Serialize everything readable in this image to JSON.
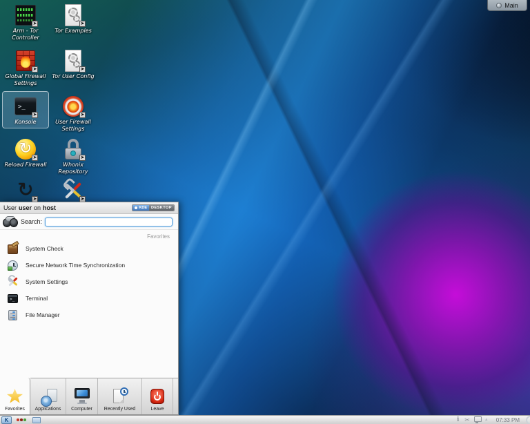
{
  "desktop": {
    "main_button_label": "Main",
    "icons": [
      {
        "label": "Arm - Tor Controller"
      },
      {
        "label": "Tor Examples"
      },
      {
        "label": "Global Firewall Settings"
      },
      {
        "label": "Tor User Config"
      },
      {
        "label": "Konsole"
      },
      {
        "label": "User Firewall Settings"
      },
      {
        "label": "Reload Firewall"
      },
      {
        "label": "Whonix Repository"
      },
      {
        "label": ""
      },
      {
        "label": ""
      }
    ],
    "shortcut_badge": "➤"
  },
  "kickoff": {
    "header": {
      "prefix": "User",
      "user": "user",
      "middle": "on",
      "host": "host"
    },
    "badge": {
      "kde": "KDE",
      "desktop": "DESKTOP"
    },
    "search": {
      "label": "Search:",
      "value": ""
    },
    "section_label": "Favorites",
    "items": [
      {
        "label": "System Check"
      },
      {
        "label": "Secure Network Time Synchronization"
      },
      {
        "label": "System Settings"
      },
      {
        "label": "Terminal"
      },
      {
        "label": "File Manager"
      }
    ],
    "tabs": [
      {
        "label": "Favorites"
      },
      {
        "label": "Applications"
      },
      {
        "label": "Computer"
      },
      {
        "label": "Recently Used"
      },
      {
        "label": "Leave"
      }
    ]
  },
  "taskbar": {
    "launcher_glyph": "K",
    "clock": "07:33 PM"
  },
  "colors": {
    "accent_blue": "#1566b2",
    "purple_glow": "#b412c8",
    "teal_corner": "#14604f",
    "menu_bg": "#fbfbfb",
    "panel_bg": "#dcdcdc"
  }
}
